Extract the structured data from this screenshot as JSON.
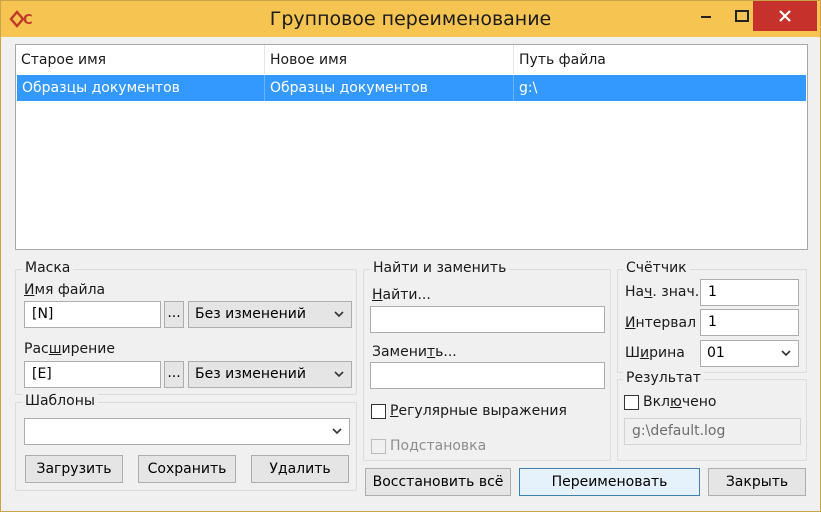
{
  "window": {
    "title": "Групповое переименование",
    "accent": "#f5c451",
    "close_color": "#c7312b"
  },
  "filelist": {
    "columns": [
      "Старое имя",
      "Новое имя",
      "Путь файла"
    ],
    "rows": [
      {
        "old_name": "Образцы документов",
        "new_name": "Образцы документов",
        "path": "g:\\"
      }
    ],
    "selection_color": "#3399ff"
  },
  "mask": {
    "legend": "Маска",
    "filename_label": "Имя файла",
    "filename_value": "[N]",
    "filename_case": "Без изменений",
    "ext_label": "Расширение",
    "ext_value": "[E]",
    "ext_case": "Без изменений",
    "browse_label": "..."
  },
  "templates": {
    "legend": "Шаблоны",
    "value": "",
    "load_label": "Загрузить",
    "save_label": "Сохранить",
    "delete_label": "Удалить"
  },
  "find_replace": {
    "legend": "Найти и заменить",
    "find_label": "Найти...",
    "find_value": "",
    "replace_label": "Заменить...",
    "replace_value": "",
    "regex_label": "Регулярные выражения",
    "subst_label": "Подстановка"
  },
  "counter": {
    "legend": "Счётчик",
    "start_label": "Нач. знач.",
    "start_value": "1",
    "interval_label": "Интервал",
    "interval_value": "1",
    "width_label": "Ширина",
    "width_value": "01"
  },
  "result": {
    "legend": "Результат",
    "enabled_label": "Включено",
    "log_path": "g:\\default.log"
  },
  "buttons": {
    "restore_label": "Восстановить всё",
    "rename_label": "Переименовать",
    "close_label": "Закрыть"
  }
}
